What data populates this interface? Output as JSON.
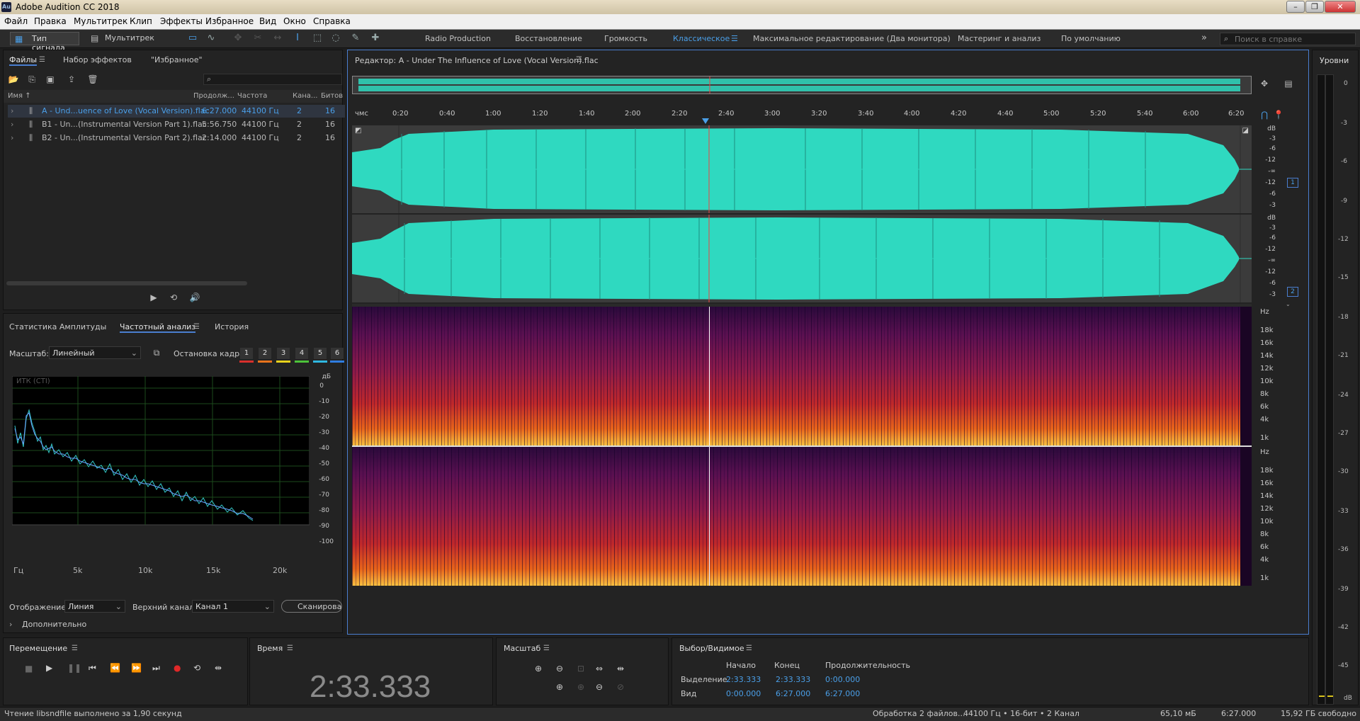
{
  "window": {
    "title": "Adobe Audition CC 2018",
    "logo_text": "Au"
  },
  "menu": [
    "Файл",
    "Правка",
    "Мультитрек",
    "Клип",
    "Эффекты",
    "Избранное",
    "Вид",
    "Окно",
    "Справка"
  ],
  "toolbar": {
    "mode_waveform": "Тип сигнала",
    "mode_multitrack": "Мультитрек",
    "workspaces": [
      "Radio Production",
      "Восстановление",
      "Громкость",
      "Классическое",
      "Максимальное редактирование (Два монитора)",
      "Мастеринг и анализ",
      "По умолчанию"
    ],
    "active_workspace": "Классическое",
    "search_placeholder": "Поиск в справке"
  },
  "files_panel": {
    "tabs": [
      "Файлы",
      "Набор эффектов",
      "\"Избранное\""
    ],
    "columns": [
      "Имя ↑",
      "Продолж...",
      "Частота",
      "Кана...",
      "Битов"
    ],
    "rows": [
      {
        "name": "A - Und...uence of Love (Vocal Version).flac",
        "duration": "6:27.000",
        "rate": "44100 Гц",
        "channels": "2",
        "bits": "16",
        "selected": true
      },
      {
        "name": "B1 - Un...(Instrumental Version Part 1).flac",
        "duration": "5:56.750",
        "rate": "44100 Гц",
        "channels": "2",
        "bits": "16",
        "selected": false
      },
      {
        "name": "B2 - Un...(Instrumental Version Part 2).flac",
        "duration": "2:14.000",
        "rate": "44100 Гц",
        "channels": "2",
        "bits": "16",
        "selected": false
      }
    ]
  },
  "analysis_panel": {
    "tabs": [
      "Статистика Амплитуды",
      "Частотный анализ",
      "История"
    ],
    "scale_label": "Масштаб:",
    "scale_value": "Линейный",
    "freeze_label": "Остановка кадра:",
    "freeze_slots": [
      "1",
      "2",
      "3",
      "4",
      "5",
      "6"
    ],
    "slot_colors": [
      "#d9302c",
      "#e8731c",
      "#e8d21c",
      "#4cc23a",
      "#2fb7e0",
      "#2f7de0"
    ],
    "graph_label": "ИТК (СТI)",
    "db_unit": "дБ",
    "db_ticks": [
      "0",
      "-10",
      "-20",
      "-30",
      "-40",
      "-50",
      "-60",
      "-70",
      "-80",
      "-90",
      "-100"
    ],
    "freq_ticks": [
      "Гц",
      "5k",
      "10k",
      "15k",
      "20k"
    ],
    "display_label": "Отображение:",
    "display_value": "Линия",
    "channel_label": "Верхний канал:",
    "channel_value": "Канал 1",
    "scan_button": "Сканировать",
    "advanced": "Дополнительно"
  },
  "editor": {
    "title": "Редактор: A - Under The Influence of Love (Vocal Version).flac",
    "ruler": [
      "чмс",
      "0:20",
      "0:40",
      "1:00",
      "1:20",
      "1:40",
      "2:00",
      "2:20",
      "2:40",
      "3:00",
      "3:20",
      "3:40",
      "4:00",
      "4:20",
      "4:40",
      "5:00",
      "5:20",
      "5:40",
      "6:00",
      "6:20"
    ],
    "db_scale": [
      "dB",
      "-3",
      "-6",
      "-12",
      "-∞",
      "-12",
      "-6",
      "-3"
    ],
    "channel_badges": [
      "1",
      "2"
    ],
    "hz_scale": [
      "Hz",
      "18k",
      "16k",
      "14k",
      "12k",
      "10k",
      "8k",
      "6k",
      "4k",
      "1k"
    ],
    "waveform_color": "#2fd9c0",
    "playhead_fraction": 0.3966
  },
  "levels": {
    "title": "Уровни",
    "ticks": [
      "0",
      "-3",
      "-6",
      "-9",
      "-12",
      "-15",
      "-18",
      "-21",
      "-24",
      "-27",
      "-30",
      "-33",
      "-36",
      "-39",
      "-42",
      "-45"
    ],
    "unit": "dB"
  },
  "transport": {
    "title": "Перемещение"
  },
  "time": {
    "title": "Время",
    "value": "2:33.333"
  },
  "zoom": {
    "title": "Масштаб"
  },
  "selection": {
    "title": "Выбор/Видимое",
    "col_start": "Начало",
    "col_end": "Конец",
    "col_duration": "Продолжительность",
    "row_selection": "Выделение",
    "row_view": "Вид",
    "sel_start": "2:33.333",
    "sel_end": "2:33.333",
    "sel_duration": "0:00.000",
    "view_start": "0:00.000",
    "view_end": "6:27.000",
    "view_duration": "6:27.000"
  },
  "statusbar": {
    "message": "Чтение libsndfile выполнено за 1,90 секунд",
    "processing": "Обработка 2 файлов...",
    "format": "44100 Гц • 16-бит • 2 Канал",
    "size": "65,10 мБ",
    "duration": "6:27.000",
    "free": "15,92 ГБ свободно"
  }
}
